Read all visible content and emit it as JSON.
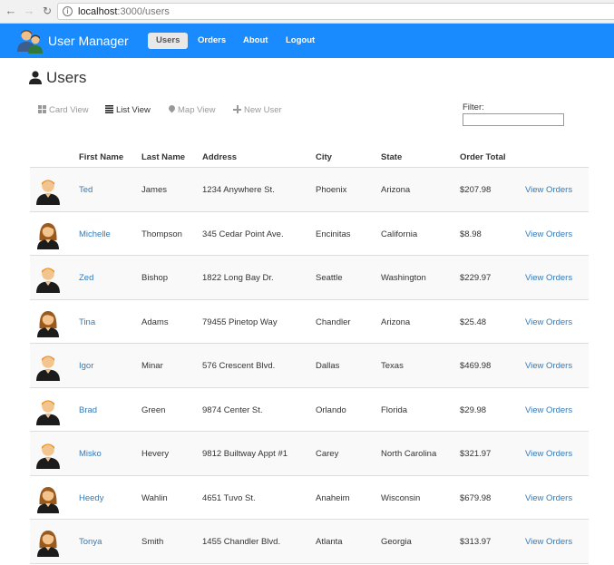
{
  "browser": {
    "url_host": "localhost",
    "url_path": ":3000/users"
  },
  "navbar": {
    "brand": "User Manager",
    "links": [
      {
        "label": "Users",
        "active": true
      },
      {
        "label": "Orders",
        "active": false
      },
      {
        "label": "About",
        "active": false
      },
      {
        "label": "Logout",
        "active": false
      }
    ]
  },
  "page": {
    "title": "Users"
  },
  "view_tabs": [
    {
      "label": "Card View",
      "icon": "grid-icon",
      "active": false
    },
    {
      "label": "List View",
      "icon": "list-icon",
      "active": true
    },
    {
      "label": "Map View",
      "icon": "map-marker-icon",
      "active": false
    },
    {
      "label": "New User",
      "icon": "plus-icon",
      "active": false
    }
  ],
  "filter": {
    "label": "Filter:",
    "value": ""
  },
  "table": {
    "headers": [
      "First Name",
      "Last Name",
      "Address",
      "City",
      "State",
      "Order Total"
    ],
    "rows": [
      {
        "gender": "male",
        "first": "Ted",
        "last": "James",
        "address": "1234 Anywhere St.",
        "city": "Phoenix",
        "state": "Arizona",
        "total": "$207.98",
        "action": "View Orders"
      },
      {
        "gender": "female",
        "first": "Michelle",
        "last": "Thompson",
        "address": "345 Cedar Point Ave.",
        "city": "Encinitas",
        "state": "California",
        "total": "$8.98",
        "action": "View Orders"
      },
      {
        "gender": "male",
        "first": "Zed",
        "last": "Bishop",
        "address": "1822 Long Bay Dr.",
        "city": "Seattle",
        "state": "Washington",
        "total": "$229.97",
        "action": "View Orders"
      },
      {
        "gender": "female",
        "first": "Tina",
        "last": "Adams",
        "address": "79455 Pinetop Way",
        "city": "Chandler",
        "state": "Arizona",
        "total": "$25.48",
        "action": "View Orders"
      },
      {
        "gender": "male",
        "first": "Igor",
        "last": "Minar",
        "address": "576 Crescent Blvd.",
        "city": "Dallas",
        "state": "Texas",
        "total": "$469.98",
        "action": "View Orders"
      },
      {
        "gender": "male",
        "first": "Brad",
        "last": "Green",
        "address": "9874 Center St.",
        "city": "Orlando",
        "state": "Florida",
        "total": "$29.98",
        "action": "View Orders"
      },
      {
        "gender": "male",
        "first": "Misko",
        "last": "Hevery",
        "address": "9812 Builtway Appt #1",
        "city": "Carey",
        "state": "North Carolina",
        "total": "$321.97",
        "action": "View Orders"
      },
      {
        "gender": "female",
        "first": "Heedy",
        "last": "Wahlin",
        "address": "4651 Tuvo St.",
        "city": "Anaheim",
        "state": "Wisconsin",
        "total": "$679.98",
        "action": "View Orders"
      },
      {
        "gender": "female",
        "first": "Tonya",
        "last": "Smith",
        "address": "1455 Chandler Blvd.",
        "city": "Atlanta",
        "state": "Georgia",
        "total": "$313.97",
        "action": "View Orders"
      }
    ]
  },
  "colors": {
    "navbar": "#1a8bff",
    "link": "#337ab7",
    "row_stripe": "#f9f9f9"
  }
}
